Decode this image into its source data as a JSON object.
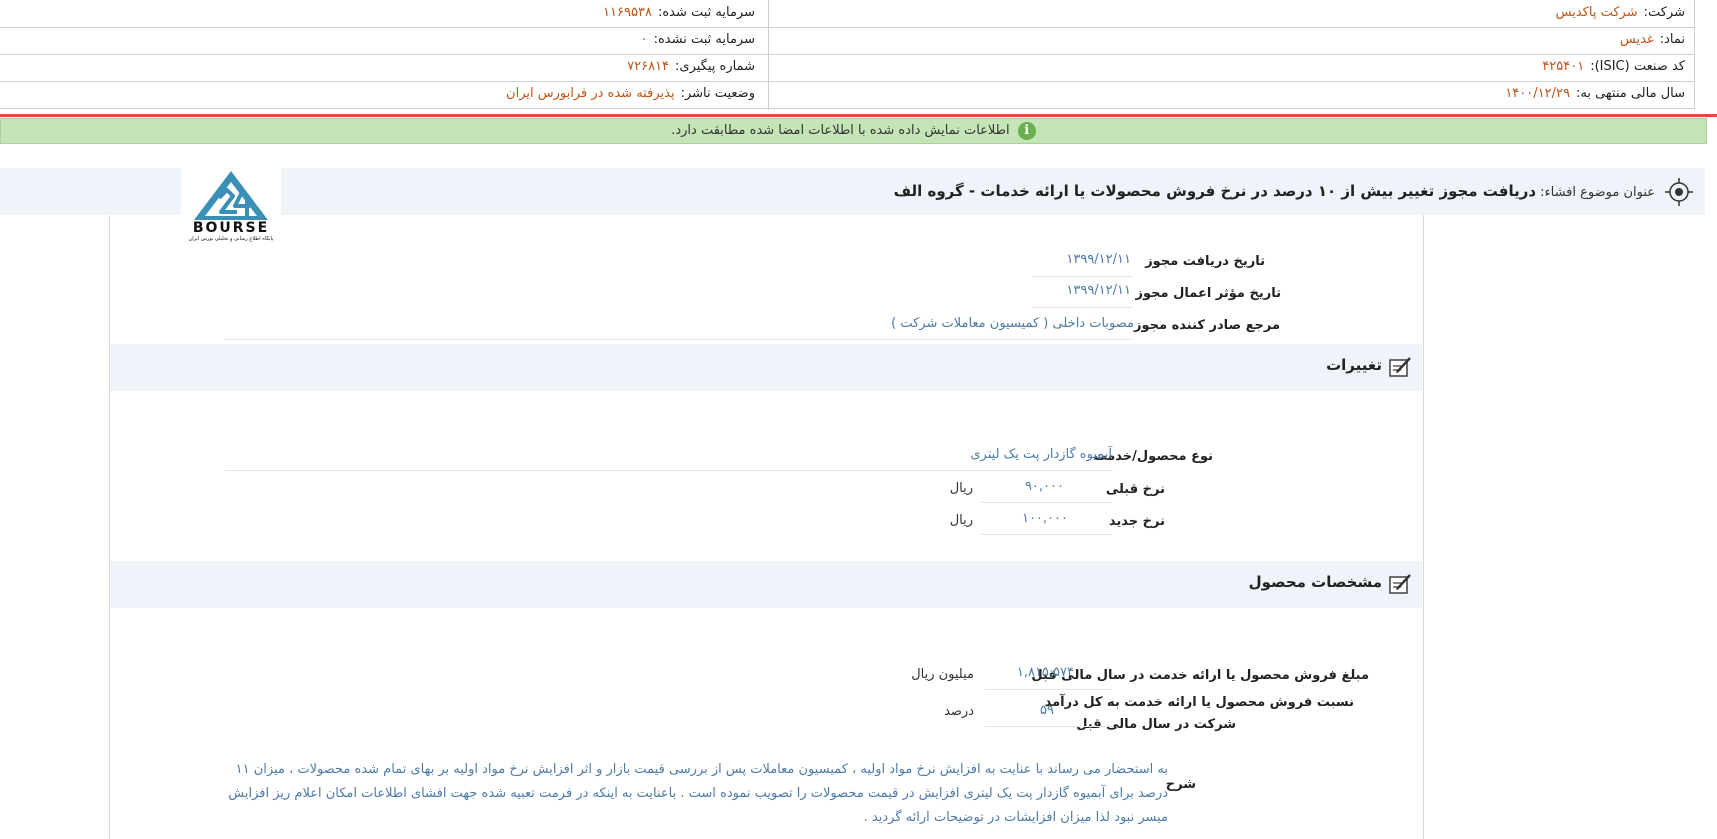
{
  "header": {
    "company_label": "شرکت:",
    "company_value": "شرکت پاکدیس",
    "symbol_label": "نماد:",
    "symbol_value": "غدیس",
    "isic_label": "کد صنعت (ISIC):",
    "isic_value": "۴۲۵۴۰۱",
    "fiscal_label": "سال مالی منتهی به:",
    "fiscal_value": "۱۴۰۰/۱۲/۲۹",
    "reg_capital_label": "سرمایه ثبت شده:",
    "reg_capital_value": "۱۱۶۹۵۳۸",
    "unreg_capital_label": "سرمایه ثبت نشده:",
    "unreg_capital_value": "۰",
    "tracking_label": "شماره پیگیری:",
    "tracking_value": "۷۲۶۸۱۴",
    "status_label": "وضعیت ناشر:",
    "status_value": "پذیرفته شده در فرابورس ایران"
  },
  "notice": {
    "icon": "info-icon",
    "text": "اطلاعات نمایش داده شده با اطلاعات امضا شده مطابقت دارد."
  },
  "title": {
    "label": "عنوان موضوع افشاء:",
    "text": "دریافت مجوز تغییر بیش از ۱۰ درصد در نرخ فروش محصولات یا ارائه خدمات - گروه الف"
  },
  "logo": {
    "text": "BOURSE",
    "subtitle": "پایگاه اطلاع رسانی و تحلیلی بورس ایران",
    "color": "#3a8fb7"
  },
  "permit": {
    "receive_date_label": "تاریخ دریافت مجوز",
    "receive_date_value": "۱۳۹۹/۱۲/۱۱",
    "effective_date_label": "تاریخ مؤثر اعمال مجوز",
    "effective_date_value": "۱۳۹۹/۱۲/۱۱",
    "issuer_label": "مرجع صادر کننده مجوز",
    "issuer_value": "مصوبات داخلی ( کمیسیون معاملات شرکت )"
  },
  "changes": {
    "section_title": "تغییرات",
    "product_label": "نوع محصول/خدمت",
    "product_value": "آبمیوه گازدار پت یک لیتری",
    "prev_rate_label": "نرخ قبلی",
    "prev_rate_value": "۹۰,۰۰۰",
    "prev_rate_unit": "ریال",
    "new_rate_label": "نرخ جدید",
    "new_rate_value": "۱۰۰,۰۰۰",
    "new_rate_unit": "ریال"
  },
  "product_specs": {
    "section_title": "مشخصات محصول",
    "sales_label": "مبلغ فروش محصول یا ارائه خدمت در سال مالی قبل",
    "sales_value": "۱,۸۱۵,۵۷۴",
    "sales_unit": "میلیون ریال",
    "share_label_1": "نسبت فروش محصول یا ارائه خدمت به کل درآمد",
    "share_label_2": "شرکت در سال مالی قبل",
    "share_value": "۵۹",
    "share_unit": "درصد"
  },
  "description": {
    "label": "شرح",
    "text": "به استحضار می رساند با عنایت به افزایش نرخ مواد اولیه ، کمیسیون معاملات پس از بررسی قیمت بازار و اثر افزایش نرخ مواد اولیه بر بهای تمام شده محصولات ، میزان ۱۱ درصد برای آبمیوه گازدار پت یک لیتری افزایش در قیمت محصولات را تصویب نموده است . باعنایت به اینکه در فرمت تعبیه شده جهت افشای اطلاعات امکان اعلام ریز افزایش میسر نبود لذا میزان افزایشات در توضیحات ارائه گردید ."
  }
}
